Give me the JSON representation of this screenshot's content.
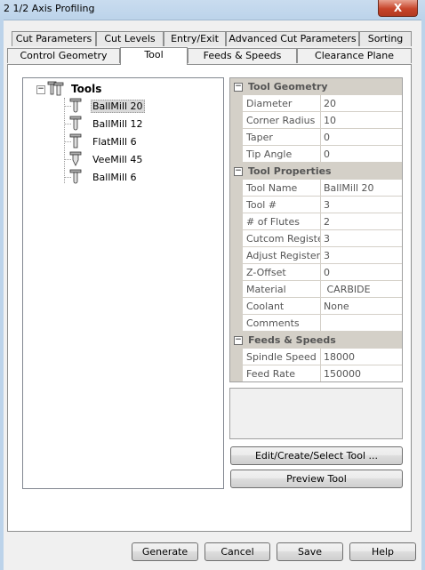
{
  "window": {
    "title": "2 1/2 Axis Profiling",
    "close_label": "X"
  },
  "tabs_row1": [
    "Cut Parameters",
    "Cut Levels",
    "Entry/Exit",
    "Advanced Cut Parameters",
    "Sorting"
  ],
  "tabs_row2": [
    "Control Geometry",
    "Tool",
    "Feeds & Speeds",
    "Clearance Plane"
  ],
  "active_tab": "Tool",
  "tree": {
    "root_label": "Tools",
    "items": [
      {
        "label": "BallMill 20",
        "icon": "ballmill-icon",
        "selected": true
      },
      {
        "label": "BallMill 12",
        "icon": "ballmill-icon",
        "selected": false
      },
      {
        "label": "FlatMill 6",
        "icon": "flatmill-icon",
        "selected": false
      },
      {
        "label": "VeeMill 45",
        "icon": "veemill-icon",
        "selected": false
      },
      {
        "label": "BallMill 6",
        "icon": "ballmill-icon",
        "selected": false
      }
    ]
  },
  "properties": {
    "tool_geometry": {
      "label": "Tool Geometry",
      "rows": [
        {
          "name": "Diameter",
          "value": "20"
        },
        {
          "name": "Corner Radius",
          "value": "10"
        },
        {
          "name": "Taper",
          "value": "0"
        },
        {
          "name": "Tip Angle",
          "value": "0"
        }
      ]
    },
    "tool_properties": {
      "label": "Tool Properties",
      "rows": [
        {
          "name": "Tool Name",
          "value": "BallMill 20"
        },
        {
          "name": "Tool #",
          "value": "3"
        },
        {
          "name": "# of Flutes",
          "value": "2"
        },
        {
          "name": "Cutcom Registe",
          "value": "3"
        },
        {
          "name": "Adjust Register",
          "value": "3"
        },
        {
          "name": "Z-Offset",
          "value": "0"
        },
        {
          "name": "Material",
          "value": " CARBIDE"
        },
        {
          "name": "Coolant",
          "value": "None"
        },
        {
          "name": "Comments",
          "value": ""
        }
      ]
    },
    "feeds_speeds": {
      "label": "Feeds & Speeds",
      "rows": [
        {
          "name": "Spindle Speed",
          "value": "18000"
        },
        {
          "name": "Feed Rate",
          "value": "150000"
        }
      ]
    }
  },
  "buttons": {
    "edit_tool": "Edit/Create/Select Tool ...",
    "preview_tool": "Preview Tool",
    "generate": "Generate",
    "cancel": "Cancel",
    "save": "Save",
    "help": "Help"
  },
  "colors": {
    "titlebar": "#bcd3ea",
    "close": "#c7442a",
    "category": "#d4d0c8",
    "selection": "#d9d9d9"
  }
}
